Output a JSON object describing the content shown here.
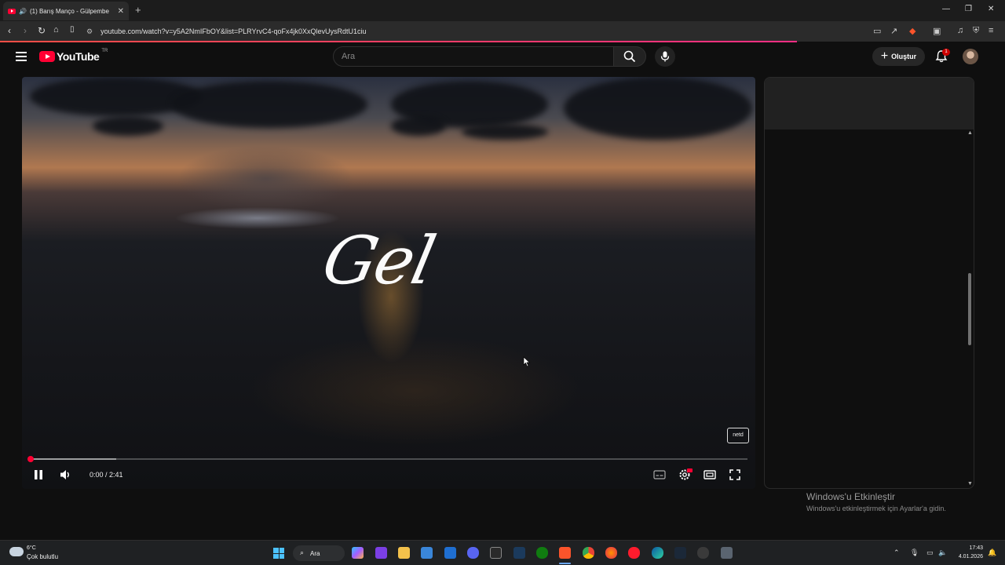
{
  "browser": {
    "tab_title": "(1) Barış Manço - Gülpembe",
    "url": "youtube.com/watch?v=y5A2NmIFbOY&list=PLRYrvC4-qoFx4jk0XxQlevUysRdtU1ciu"
  },
  "youtube": {
    "logo_text": "YouTube",
    "country_code": "TR",
    "search_placeholder": "Ara",
    "create_label": "Oluştur",
    "notification_count": "1"
  },
  "player": {
    "overlay_title": "Gel",
    "watermark": "netd",
    "time_current": "0:00",
    "time_separator": " / ",
    "time_total": "2:41",
    "progress_fraction": 0.0,
    "buffered_fraction": 0.12
  },
  "windows_notice": {
    "title": "Windows'u Etkinleştir",
    "subtitle": "Windows'u etkinleştirmek için Ayarlar'a gidin."
  },
  "taskbar": {
    "weather_temp": "6°C",
    "weather_desc": "Çok bulutlu",
    "search_label": "Ara",
    "clock_time": "17:43",
    "clock_date": "4.01.2026"
  },
  "colors": {
    "youtube_red": "#ff0033",
    "background": "#0f0f0f"
  }
}
